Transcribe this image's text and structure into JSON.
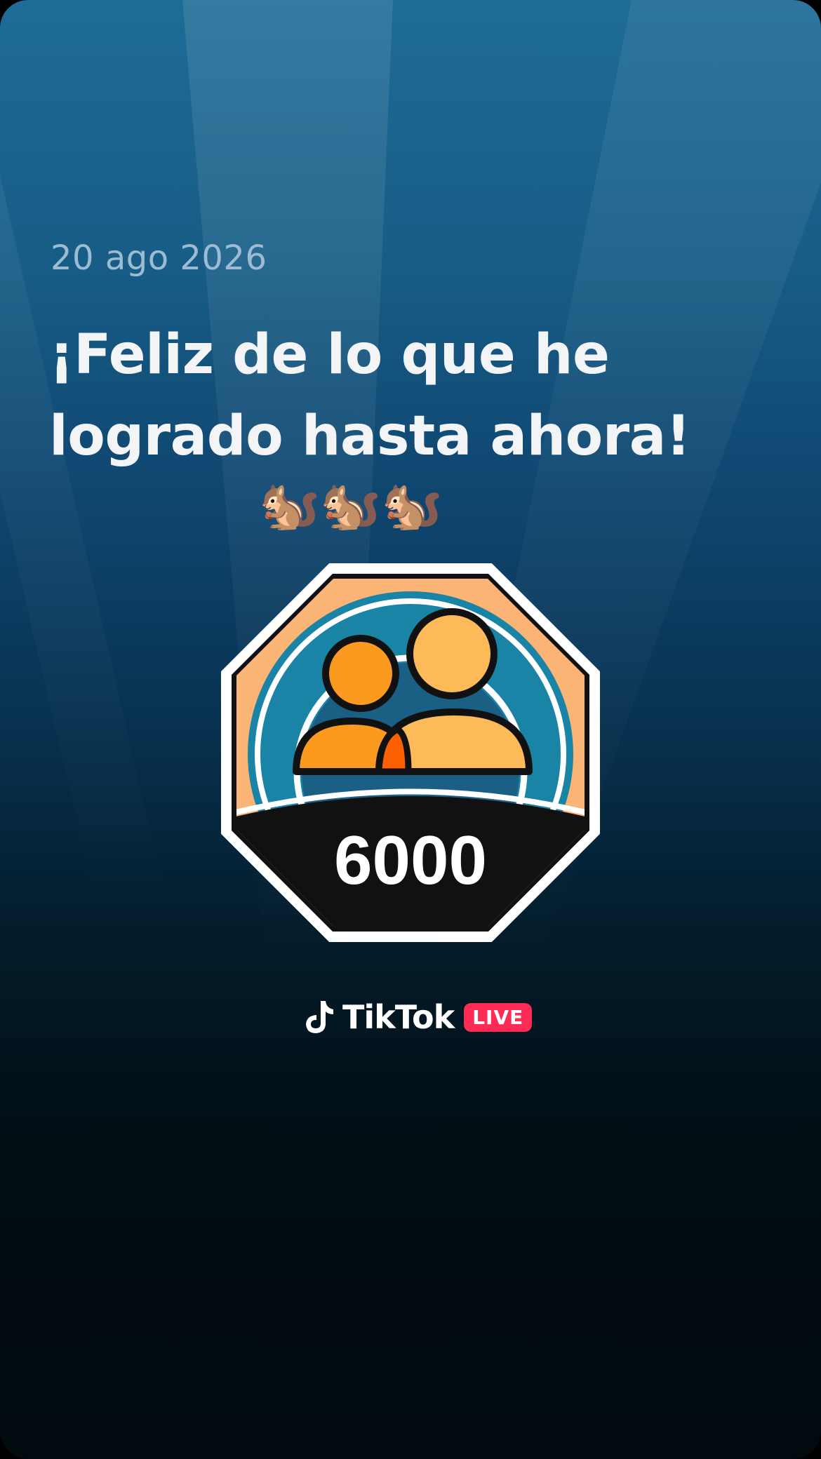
{
  "card": {
    "date": "20 ago 2026",
    "headline": "¡Feliz de lo que he logrado hasta ahora!",
    "emojis": "🐿️🐿️🐿️"
  },
  "badge": {
    "count": "6000",
    "icon": "followers-milestone-icon",
    "colors": {
      "frame": "#ffffff",
      "peach": "#f9b476",
      "ring_blue": "#1a84a6",
      "inner_blue": "#1a5f84",
      "orange": "#fb9a1e",
      "light_orange": "#fcbb58",
      "overlap": "#fd6000",
      "banner": "#000000"
    }
  },
  "branding": {
    "app_name": "TikTok",
    "live_label": "LIVE",
    "logo_icon": "tiktok-note-icon",
    "accent": "#fe2c55"
  }
}
